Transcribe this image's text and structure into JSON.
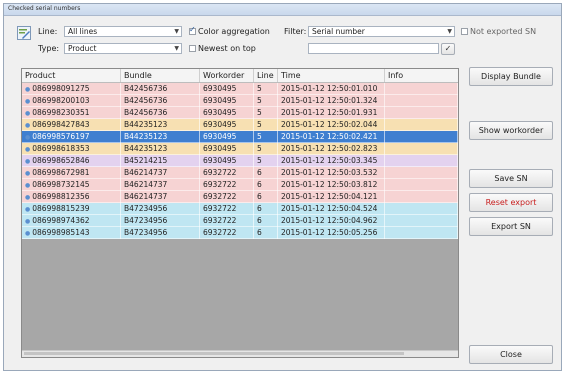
{
  "window": {
    "title": "Checked serial numbers"
  },
  "toolbar": {
    "line_label": "Line:",
    "line_value": "All lines",
    "type_label": "Type:",
    "type_value": "Product",
    "color_aggregation_label": "Color aggregation",
    "color_aggregation_checked": true,
    "newest_on_top_label": "Newest on top",
    "newest_on_top_checked": false,
    "filter_label": "Filter:",
    "filter_value": "Serial number",
    "filter_text": "",
    "not_exported_label": "Not exported SN",
    "not_exported_checked": false,
    "apply_icon": "checkmark-icon",
    "app_icon": "pencil-edit-icon"
  },
  "grid": {
    "columns": [
      "Product",
      "Bundle",
      "Workorder",
      "Line",
      "Time",
      "Info"
    ],
    "rows": [
      {
        "product": "086998091275",
        "bundle": "B42456736",
        "workorder": "6930495",
        "line": "5",
        "time": "2015-01-12 12:50:01.010",
        "info": "",
        "color": "#f6d3d3"
      },
      {
        "product": "086998200103",
        "bundle": "B42456736",
        "workorder": "6930495",
        "line": "5",
        "time": "2015-01-12 12:50:01.324",
        "info": "",
        "color": "#f6d3d3"
      },
      {
        "product": "086998230351",
        "bundle": "B42456736",
        "workorder": "6930495",
        "line": "5",
        "time": "2015-01-12 12:50:01.931",
        "info": "",
        "color": "#f6d3d3"
      },
      {
        "product": "086998427843",
        "bundle": "B44235123",
        "workorder": "6930495",
        "line": "5",
        "time": "2015-01-12 12:50:02.044",
        "info": "",
        "color": "#f7e0b2"
      },
      {
        "product": "086998576197",
        "bundle": "B44235123",
        "workorder": "6930495",
        "line": "5",
        "time": "2015-01-12 12:50:02.421",
        "info": "",
        "color": "#3f7fd0",
        "selected": true
      },
      {
        "product": "086998618353",
        "bundle": "B44235123",
        "workorder": "6930495",
        "line": "5",
        "time": "2015-01-12 12:50:02.823",
        "info": "",
        "color": "#f7e0b2"
      },
      {
        "product": "086998652846",
        "bundle": "B45214215",
        "workorder": "6930495",
        "line": "5",
        "time": "2015-01-12 12:50:03.345",
        "info": "",
        "color": "#e3d2ef"
      },
      {
        "product": "086998672981",
        "bundle": "B46214737",
        "workorder": "6932722",
        "line": "6",
        "time": "2015-01-12 12:50:03.532",
        "info": "",
        "color": "#f6d3d3"
      },
      {
        "product": "086998732145",
        "bundle": "B46214737",
        "workorder": "6932722",
        "line": "6",
        "time": "2015-01-12 12:50:03.812",
        "info": "",
        "color": "#f6d3d3"
      },
      {
        "product": "086998812356",
        "bundle": "B46214737",
        "workorder": "6932722",
        "line": "6",
        "time": "2015-01-12 12:50:04.121",
        "info": "",
        "color": "#f6d3d3"
      },
      {
        "product": "086998815239",
        "bundle": "B47234956",
        "workorder": "6932722",
        "line": "6",
        "time": "2015-01-12 12:50:04.524",
        "info": "",
        "color": "#bfe6f2"
      },
      {
        "product": "086998974362",
        "bundle": "B47234956",
        "workorder": "6932722",
        "line": "6",
        "time": "2015-01-12 12:50:04.962",
        "info": "",
        "color": "#bfe6f2"
      },
      {
        "product": "086998985143",
        "bundle": "B47234956",
        "workorder": "6932722",
        "line": "6",
        "time": "2015-01-12 12:50:05.256",
        "info": "",
        "color": "#bfe6f2"
      }
    ]
  },
  "buttons": {
    "display_bundle": "Display Bundle",
    "show_workorder": "Show workorder",
    "save_sn": "Save SN",
    "reset_export": "Reset export",
    "export_sn": "Export SN",
    "close": "Close"
  },
  "colors": {
    "accent_red": "#c81e1e",
    "selection": "#3f7fd0"
  }
}
